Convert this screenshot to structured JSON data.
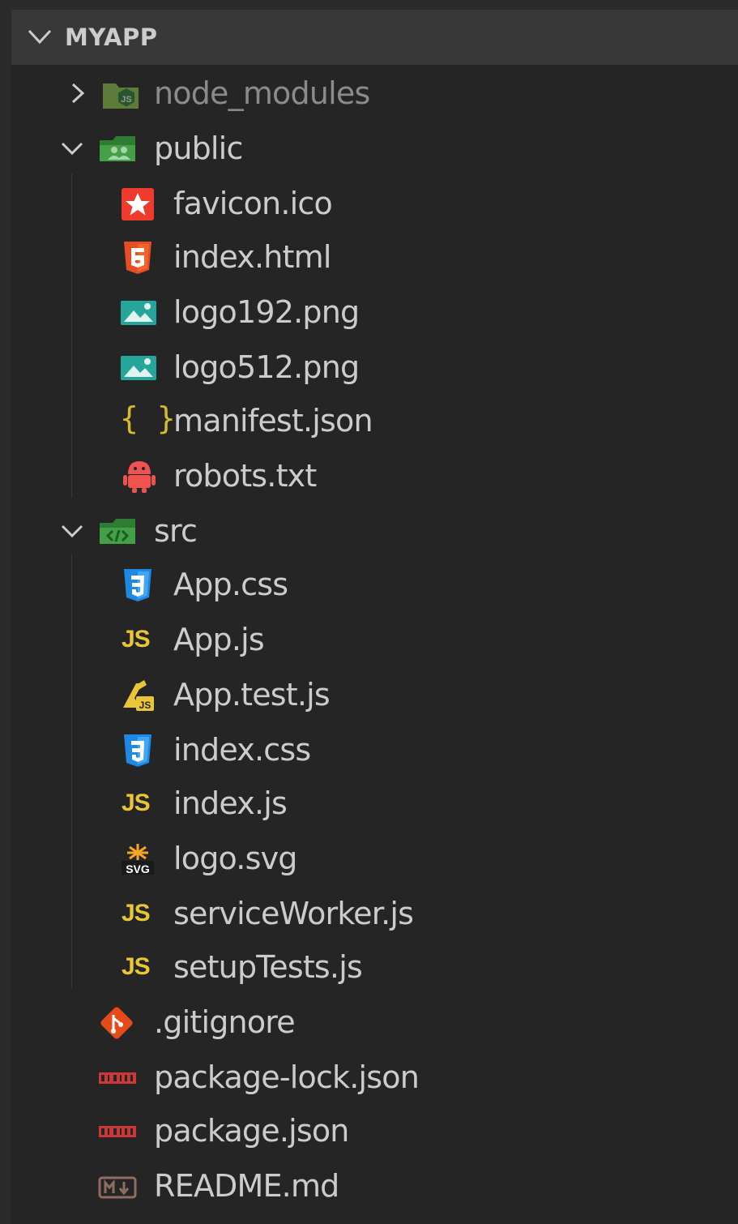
{
  "explorer": {
    "title": "MYAPP",
    "items": [
      {
        "label": "node_modules",
        "icon": "nodejs-folder-icon",
        "type": "folder",
        "expanded": false,
        "depth": 1
      },
      {
        "label": "public",
        "icon": "public-folder-icon",
        "type": "folder",
        "expanded": true,
        "depth": 1
      },
      {
        "label": "favicon.ico",
        "icon": "favicon-icon",
        "type": "file",
        "depth": 2
      },
      {
        "label": "index.html",
        "icon": "html5-icon",
        "type": "file",
        "depth": 2
      },
      {
        "label": "logo192.png",
        "icon": "image-icon",
        "type": "file",
        "depth": 2
      },
      {
        "label": "logo512.png",
        "icon": "image-icon",
        "type": "file",
        "depth": 2
      },
      {
        "label": "manifest.json",
        "icon": "json-braces-icon",
        "type": "file",
        "depth": 2,
        "glyph": "{ }"
      },
      {
        "label": "robots.txt",
        "icon": "robot-icon",
        "type": "file",
        "depth": 2
      },
      {
        "label": "src",
        "icon": "src-folder-icon",
        "type": "folder",
        "expanded": true,
        "depth": 1
      },
      {
        "label": "App.css",
        "icon": "css3-icon",
        "type": "file",
        "depth": 2
      },
      {
        "label": "App.js",
        "icon": "javascript-icon",
        "type": "file",
        "depth": 2,
        "glyph": "JS"
      },
      {
        "label": "App.test.js",
        "icon": "test-js-icon",
        "type": "file",
        "depth": 2
      },
      {
        "label": "index.css",
        "icon": "css3-icon",
        "type": "file",
        "depth": 2
      },
      {
        "label": "index.js",
        "icon": "javascript-icon",
        "type": "file",
        "depth": 2,
        "glyph": "JS"
      },
      {
        "label": "logo.svg",
        "icon": "svg-icon",
        "type": "file",
        "depth": 2
      },
      {
        "label": "serviceWorker.js",
        "icon": "javascript-icon",
        "type": "file",
        "depth": 2,
        "glyph": "JS"
      },
      {
        "label": "setupTests.js",
        "icon": "javascript-icon",
        "type": "file",
        "depth": 2,
        "glyph": "JS"
      },
      {
        "label": ".gitignore",
        "icon": "git-icon",
        "type": "file",
        "depth": 1
      },
      {
        "label": "package-lock.json",
        "icon": "npm-icon",
        "type": "file",
        "depth": 1
      },
      {
        "label": "package.json",
        "icon": "npm-icon",
        "type": "file",
        "depth": 1
      },
      {
        "label": "README.md",
        "icon": "markdown-icon",
        "type": "file",
        "depth": 1
      }
    ]
  },
  "colors": {
    "background": "#252526",
    "header": "#383838",
    "text": "#cccccc",
    "dimmed_text": "#8b8b8b",
    "js_yellow": "#e8c635",
    "folder_green": "#4caf50",
    "html_orange": "#e44d26",
    "css_blue": "#1e88e5",
    "npm_red": "#cb3837"
  }
}
